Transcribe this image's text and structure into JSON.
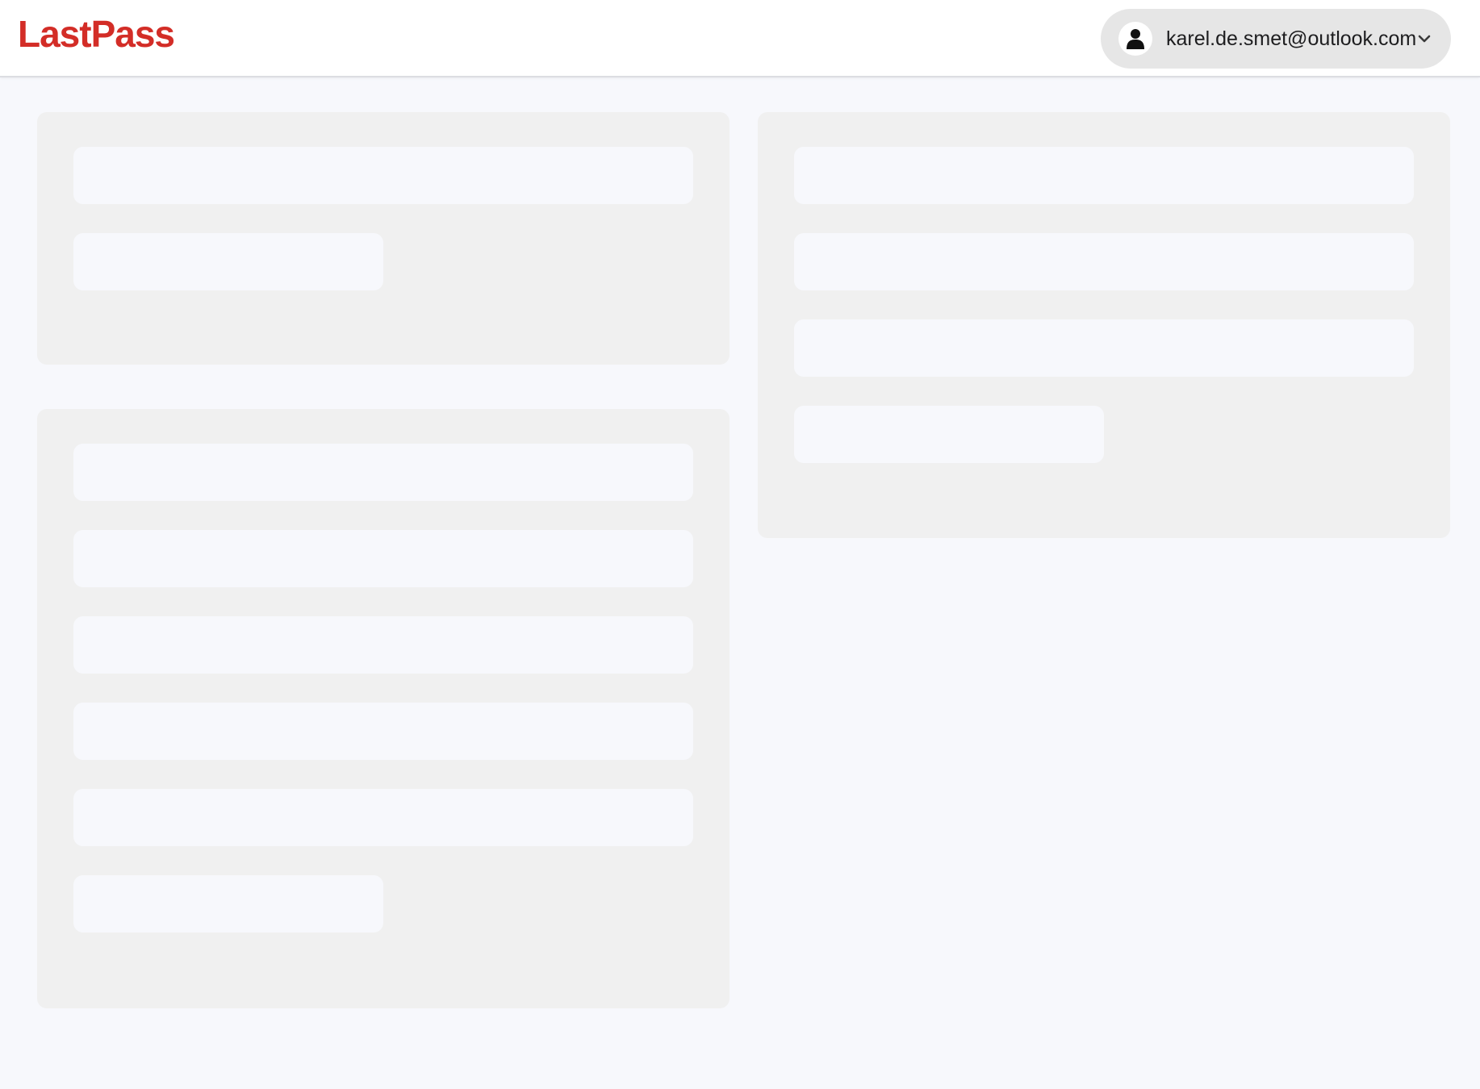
{
  "brand": {
    "logo_text": "LastPass",
    "logo_color": "#d32d27"
  },
  "account": {
    "email": "karel.de.smet@outlook.com",
    "user_icon": "person-icon",
    "dropdown_icon": "chevron-down-icon"
  },
  "colors": {
    "page_background": "#f7f8fc",
    "card_background": "#f0f0f0",
    "skeleton_bar": "#f7f8fc",
    "account_pill": "#e6e6e6"
  },
  "loading_state": {
    "cards": [
      {
        "name": "left-top-card",
        "placeholder_bars": 2
      },
      {
        "name": "left-bottom-card",
        "placeholder_bars": 6
      },
      {
        "name": "right-top-card",
        "placeholder_bars": 4
      }
    ]
  }
}
